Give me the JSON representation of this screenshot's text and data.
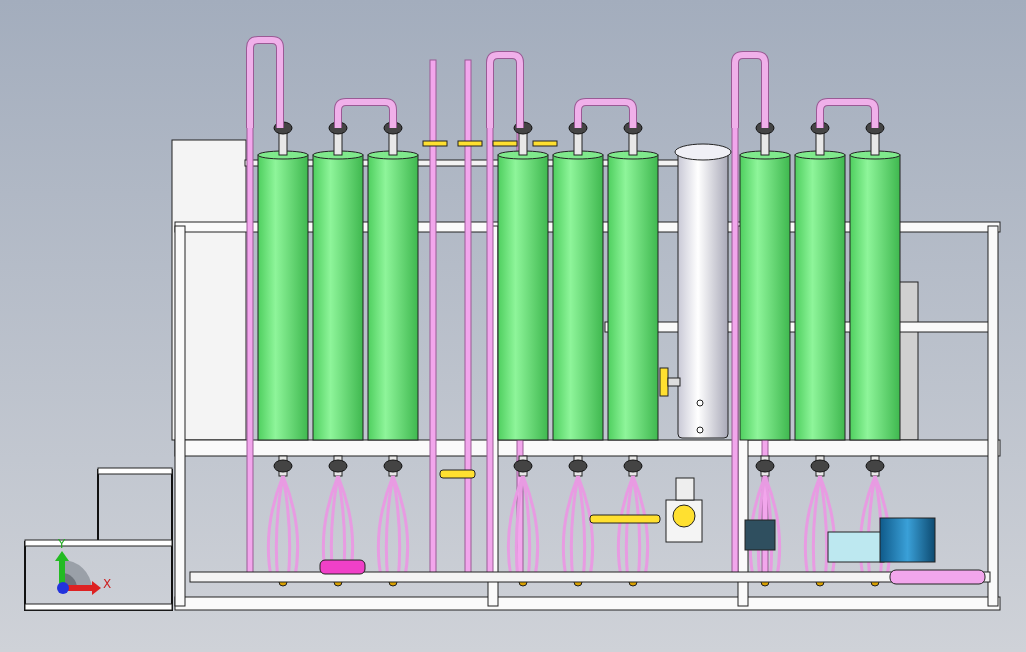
{
  "viewport": {
    "axis_triad": {
      "y_label": "Y",
      "x_label": "X"
    }
  }
}
